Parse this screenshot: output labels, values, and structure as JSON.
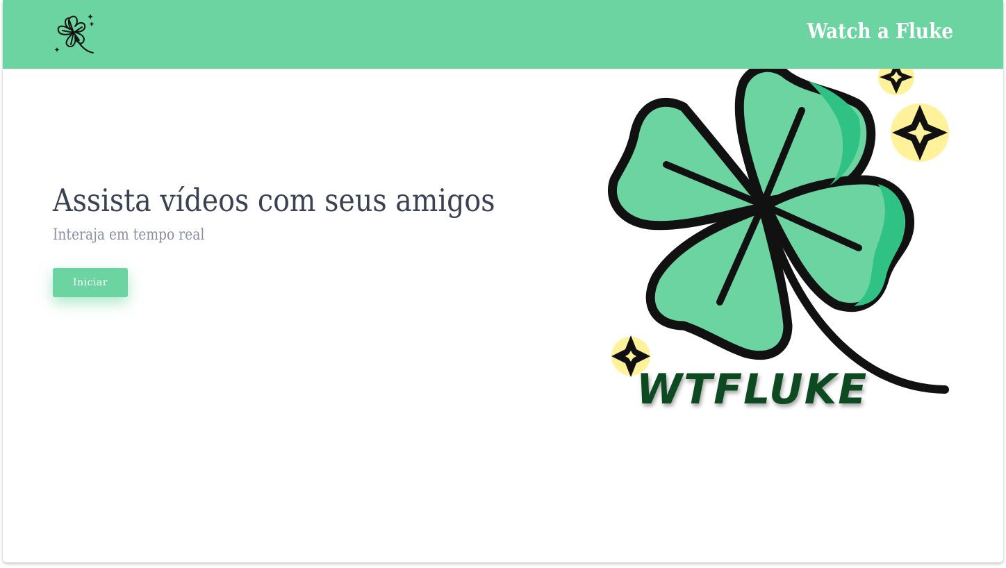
{
  "header": {
    "brand": "Watch a Fluke",
    "logo_icon": "clover-icon",
    "background_color": "#6bd4a1"
  },
  "hero": {
    "title": "Assista vídeos com seus amigos",
    "subtitle": "Interaja em tempo real",
    "start_label": "Iniciar",
    "image_icon": "clover-logo-illustration",
    "image_wordmark": "WTFLUKE"
  },
  "colors": {
    "accent": "#6bd4a1",
    "accent_dark": "#2fc284",
    "title": "#3a4153",
    "subtitle": "#8a8fa8",
    "sparkle": "#fff29a",
    "wordmark": "#0d4a22"
  }
}
